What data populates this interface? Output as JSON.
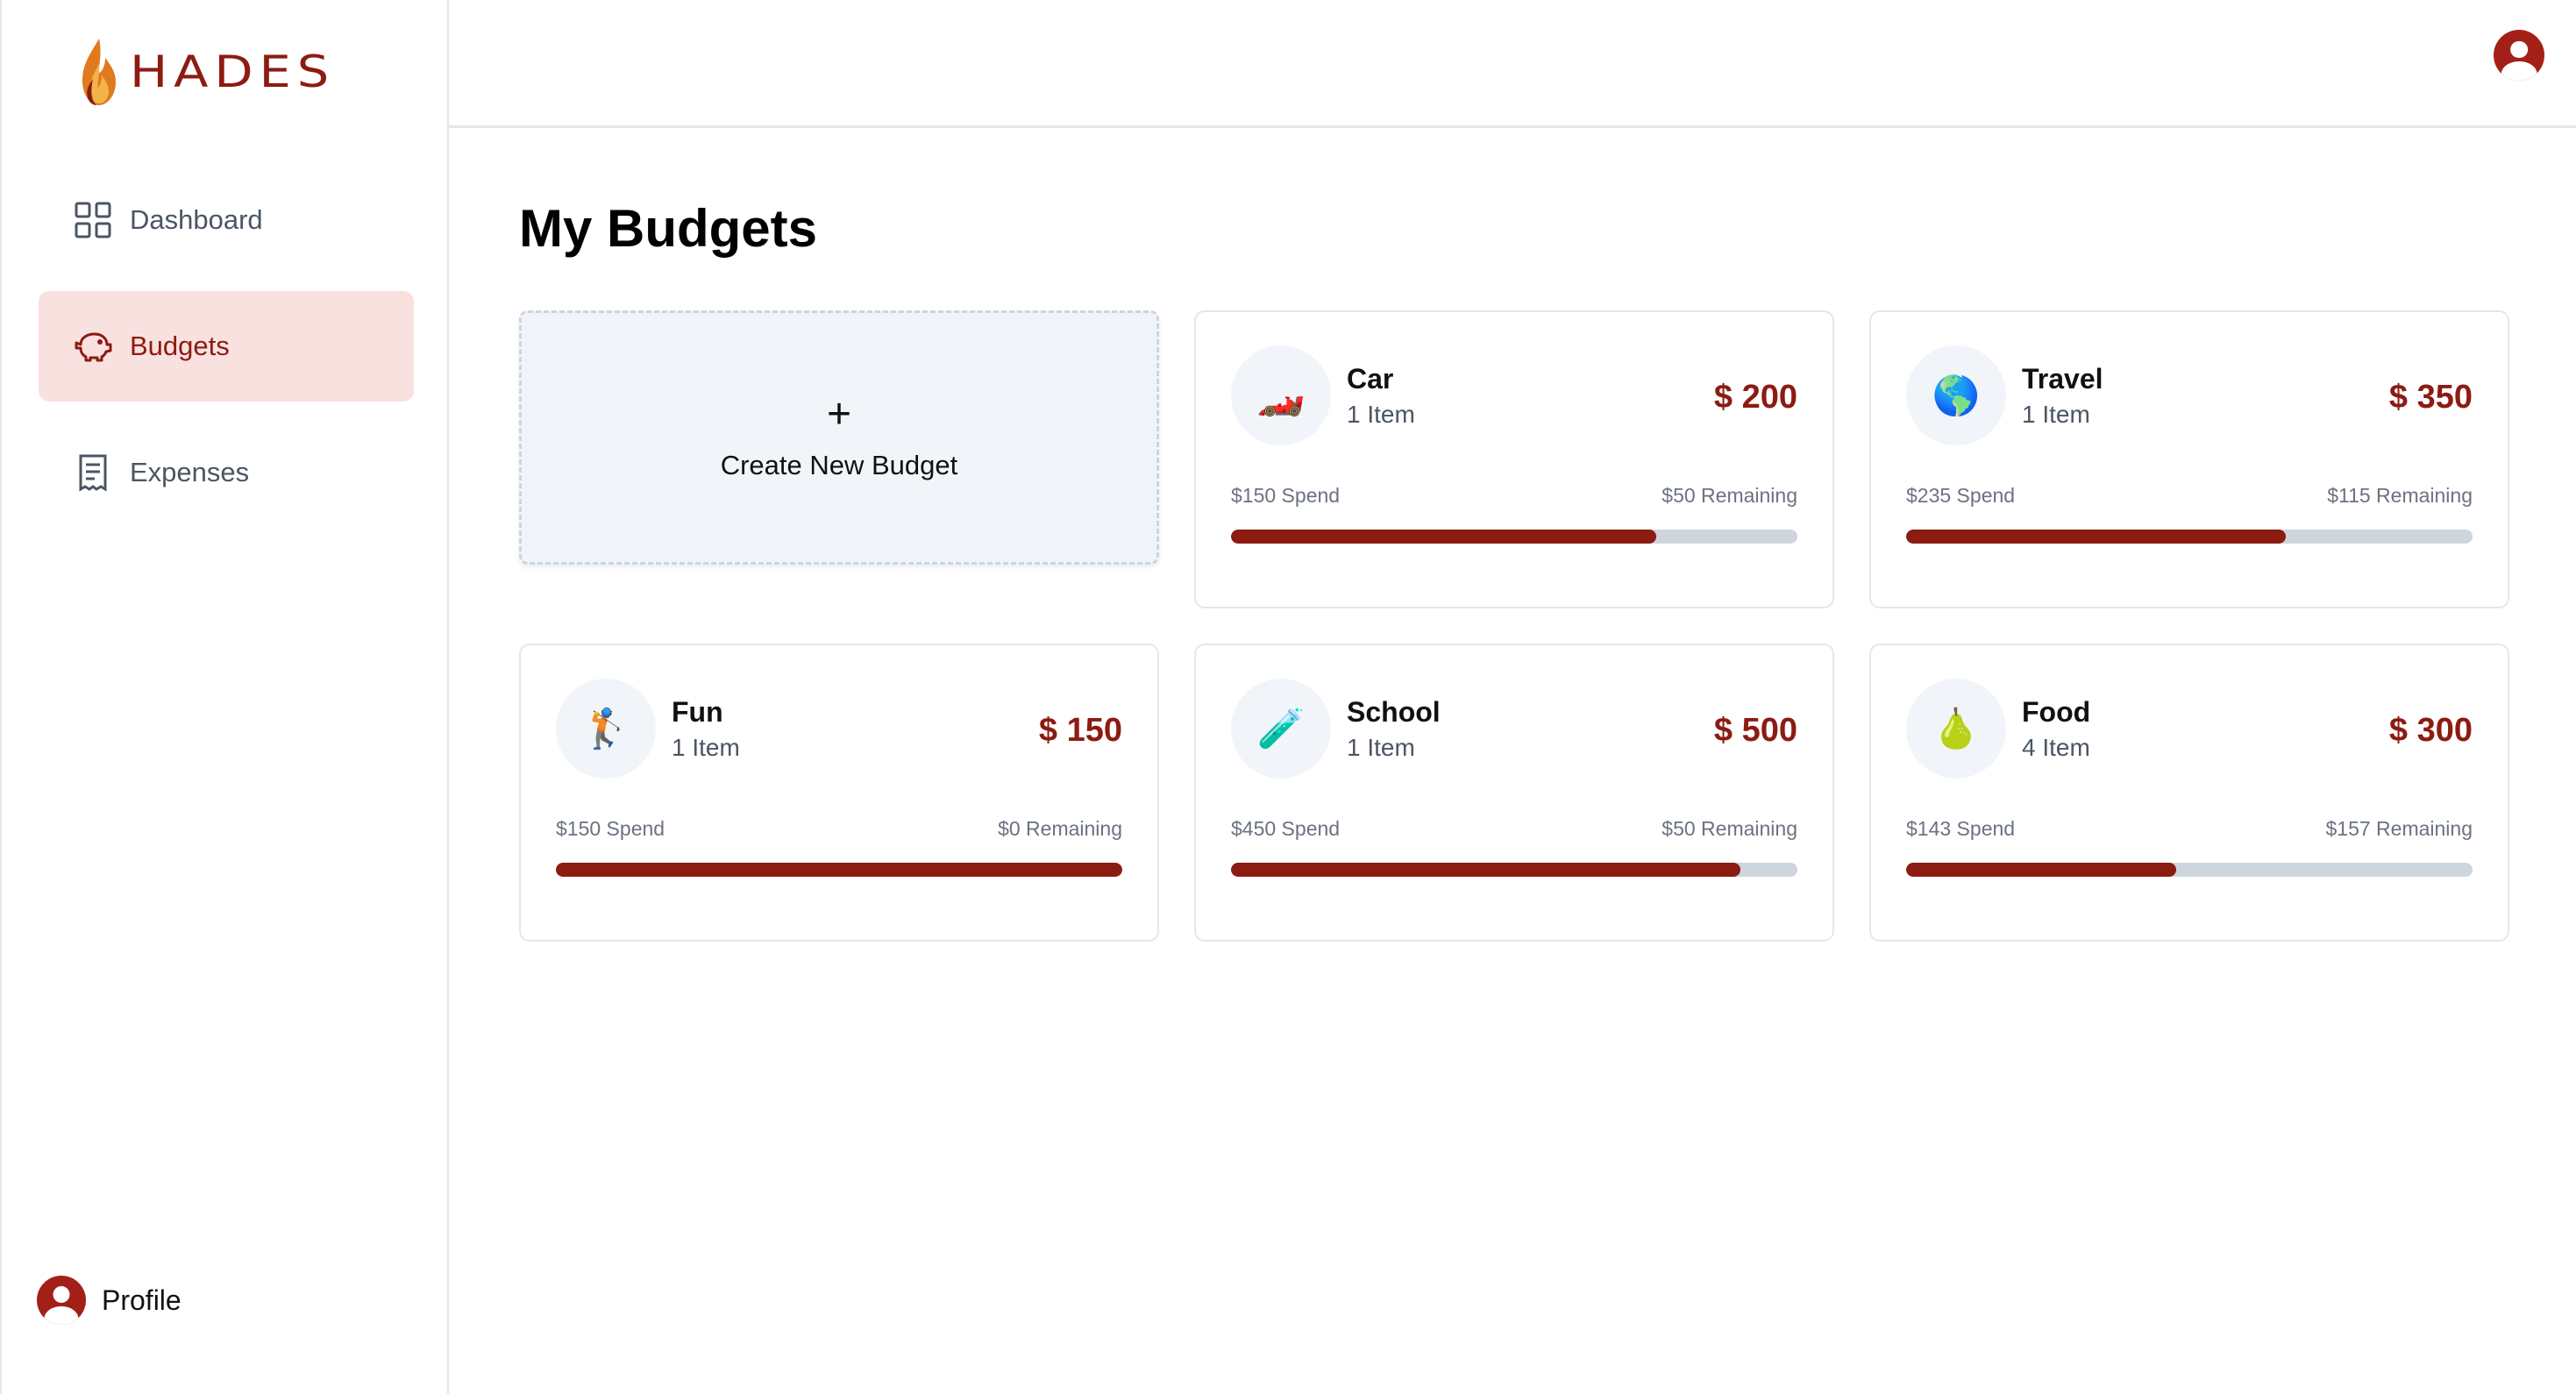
{
  "app": {
    "brand": "HADES"
  },
  "sidebar": {
    "items": [
      {
        "label": "Dashboard",
        "icon": "dashboard-grid-icon",
        "active": false
      },
      {
        "label": "Budgets",
        "icon": "piggy-bank-icon",
        "active": true
      },
      {
        "label": "Expenses",
        "icon": "receipt-icon",
        "active": false
      }
    ],
    "profile_label": "Profile"
  },
  "colors": {
    "accent": "#8c1b12",
    "active_bg": "#f9e1e0",
    "track": "#cfd5dd"
  },
  "main": {
    "title": "My Budgets",
    "create": {
      "plus": "+",
      "label": "Create New Budget"
    },
    "budgets": [
      {
        "emoji": "🏎️",
        "name": "Car",
        "items": "1 Item",
        "amount": "$ 200",
        "spend": "$150 Spend",
        "remaining": "$50 Remaining",
        "progress": 0.75
      },
      {
        "emoji": "🌎",
        "name": "Travel",
        "items": "1 Item",
        "amount": "$ 350",
        "spend": "$235 Spend",
        "remaining": "$115 Remaining",
        "progress": 0.671
      },
      {
        "emoji": "🏌️",
        "name": "Fun",
        "items": "1 Item",
        "amount": "$ 150",
        "spend": "$150 Spend",
        "remaining": "$0 Remaining",
        "progress": 1.0
      },
      {
        "emoji": "🧪",
        "name": "School",
        "items": "1 Item",
        "amount": "$ 500",
        "spend": "$450 Spend",
        "remaining": "$50 Remaining",
        "progress": 0.9
      },
      {
        "emoji": "🍐",
        "name": "Food",
        "items": "4 Item",
        "amount": "$ 300",
        "spend": "$143 Spend",
        "remaining": "$157 Remaining",
        "progress": 0.477
      }
    ]
  }
}
